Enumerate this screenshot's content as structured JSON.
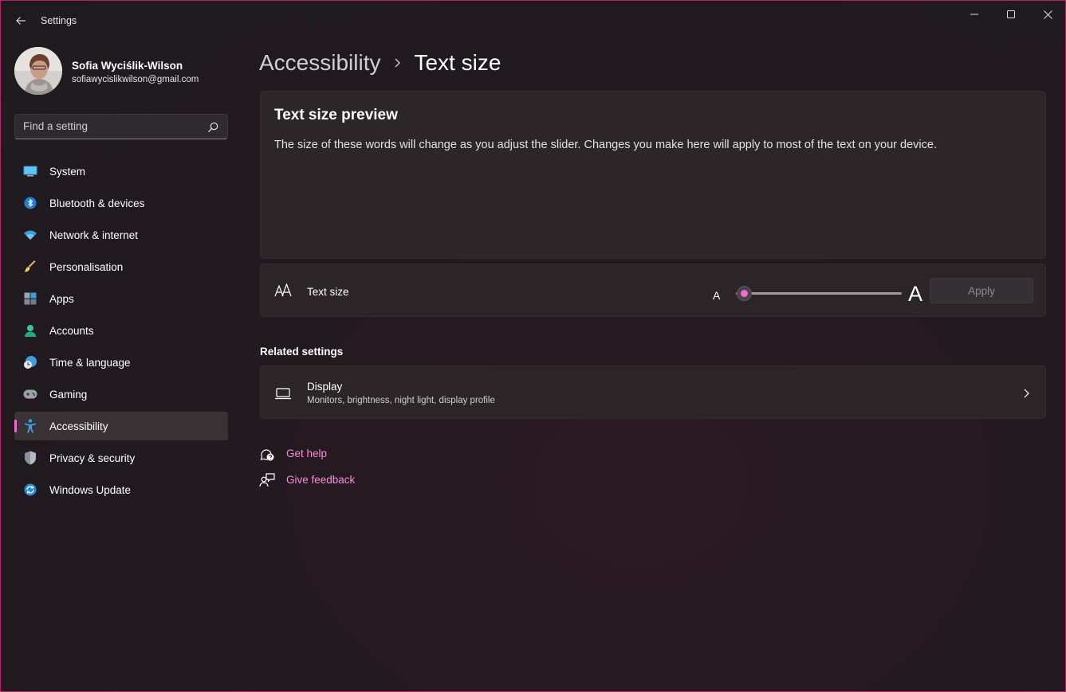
{
  "window": {
    "title": "Settings"
  },
  "profile": {
    "name": "Sofia Wyciślik-Wilson",
    "email": "sofiawycislikwilson@gmail.com"
  },
  "search": {
    "placeholder": "Find a setting"
  },
  "sidebar": {
    "items": [
      {
        "label": "System",
        "icon": "system-icon"
      },
      {
        "label": "Bluetooth & devices",
        "icon": "bluetooth-icon"
      },
      {
        "label": "Network & internet",
        "icon": "wifi-icon"
      },
      {
        "label": "Personalisation",
        "icon": "brush-icon"
      },
      {
        "label": "Apps",
        "icon": "apps-icon"
      },
      {
        "label": "Accounts",
        "icon": "person-icon"
      },
      {
        "label": "Time & language",
        "icon": "clock-globe-icon"
      },
      {
        "label": "Gaming",
        "icon": "gamepad-icon"
      },
      {
        "label": "Accessibility",
        "icon": "accessibility-icon",
        "active": true
      },
      {
        "label": "Privacy & security",
        "icon": "shield-icon"
      },
      {
        "label": "Windows Update",
        "icon": "update-icon"
      }
    ]
  },
  "breadcrumb": {
    "parent": "Accessibility",
    "current": "Text size"
  },
  "preview": {
    "title": "Text size preview",
    "text": "The size of these words will change as you adjust the slider. Changes you make here will apply to most of the text on your device."
  },
  "text_size": {
    "label": "Text size",
    "small_glyph": "A",
    "large_glyph": "A",
    "slider_value_percent": 0,
    "apply_label": "Apply"
  },
  "related": {
    "heading": "Related settings",
    "display": {
      "title": "Display",
      "subtitle": "Monitors, brightness, night light, display profile"
    }
  },
  "help": {
    "get_help": "Get help",
    "give_feedback": "Give feedback"
  },
  "colors": {
    "accent": "#f16bd0",
    "link": "#f58fdc",
    "border": "#b81e6a"
  }
}
